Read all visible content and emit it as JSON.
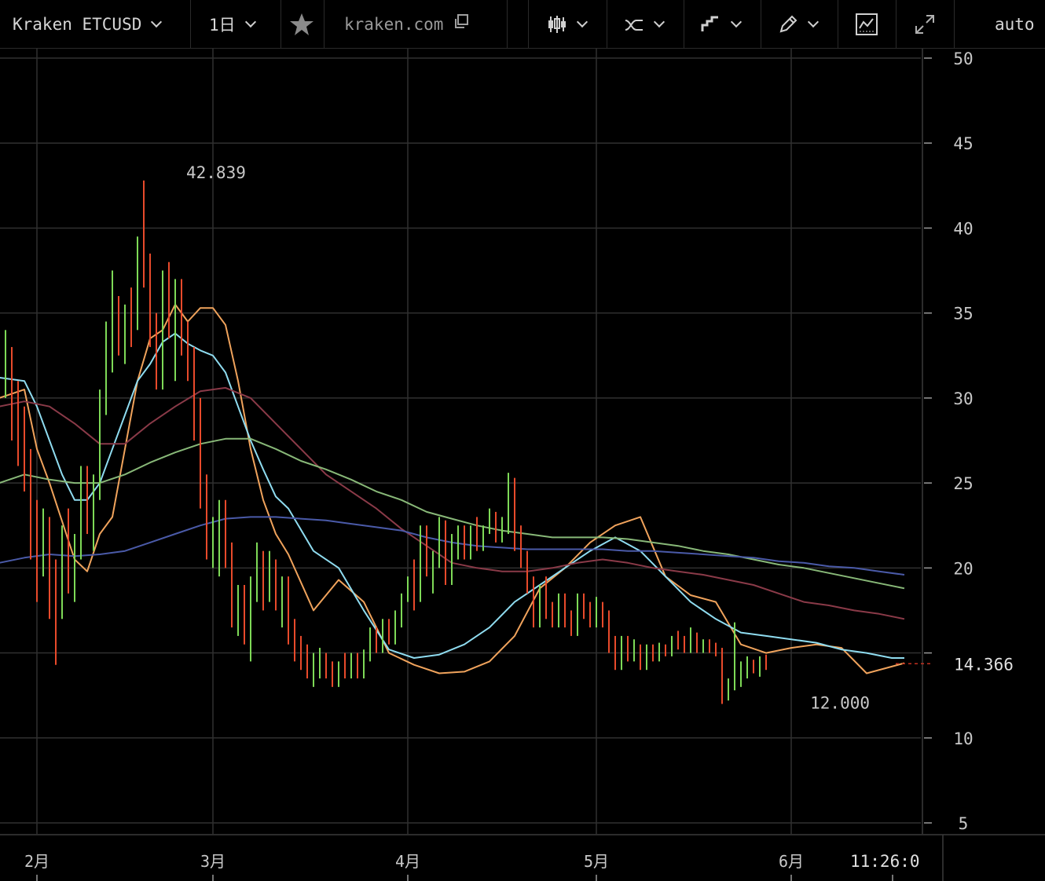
{
  "toolbar": {
    "symbol_label": "Kraken ETCUSD",
    "interval_label": "1日",
    "source_label": "kraken.com",
    "auto_label": "auto",
    "icons": [
      "star-icon",
      "external-link-icon",
      "candles-icon",
      "indicators-icon",
      "step-line-icon",
      "pencil-icon",
      "chart-settings-icon",
      "fullscreen-icon"
    ]
  },
  "colors": {
    "background": "#000000",
    "grid": "#303030",
    "up_bar": "#7ed957",
    "down_bar": "#e84a2b",
    "ma_orange": "#f0a35c",
    "ma_cyan": "#8fdcf0",
    "ma_red": "#8a3a48",
    "ma_green": "#88b878",
    "ma_blue": "#4a5aa8",
    "last_price_line": "#c03020"
  },
  "chart_data": {
    "type": "line",
    "title": "",
    "xlabel": "",
    "ylabel": "",
    "ylim": [
      3,
      51
    ],
    "y_ticks": [
      5,
      10,
      15,
      20,
      25,
      30,
      35,
      40,
      45,
      50
    ],
    "y_tick_labels": [
      "5",
      "10",
      "",
      "20",
      "25",
      "30",
      "35",
      "40",
      "45",
      "50"
    ],
    "x_tick_labels": [
      "2月",
      "3月",
      "4月",
      "5月",
      "6月"
    ],
    "x_tick_days": [
      2,
      30,
      61,
      91,
      122
    ],
    "x_range_days": [
      -4,
      140
    ],
    "last_price_label": "14.366",
    "last_price": 14.366,
    "high_label": "42.839",
    "high_value": 42.839,
    "high_day": 25,
    "low_label": "12.000",
    "low_value": 12.0,
    "low_day": 135,
    "time_label": "11:26:0",
    "bars": {
      "days_start": -4,
      "ohlc": [
        [
          30.2,
          33.5,
          29.5,
          31.5
        ],
        [
          31.5,
          34.0,
          30.0,
          32.5
        ],
        [
          32.5,
          33.0,
          27.5,
          30.5
        ],
        [
          30.5,
          31.0,
          26.0,
          28.5
        ],
        [
          28.5,
          29.5,
          24.5,
          26.0
        ],
        [
          26.0,
          27.0,
          20.5,
          23.0
        ],
        [
          23.0,
          24.0,
          18.0,
          21.0
        ],
        [
          21.0,
          23.5,
          19.5,
          22.5
        ],
        [
          22.5,
          23.0,
          17.0,
          19.0
        ],
        [
          19.0,
          20.5,
          14.3,
          17.5
        ],
        [
          17.5,
          22.5,
          17.0,
          21.5
        ],
        [
          21.5,
          23.5,
          18.5,
          19.5
        ],
        [
          19.5,
          22.0,
          18.0,
          21.5
        ],
        [
          21.5,
          26.0,
          20.5,
          25.0
        ],
        [
          25.0,
          26.0,
          22.0,
          23.5
        ],
        [
          23.5,
          25.5,
          21.0,
          24.5
        ],
        [
          24.5,
          30.5,
          24.0,
          30.0
        ],
        [
          30.0,
          34.5,
          29.0,
          33.5
        ],
        [
          33.5,
          37.5,
          31.5,
          35.0
        ],
        [
          35.0,
          36.0,
          32.5,
          33.5
        ],
        [
          33.5,
          35.5,
          32.0,
          35.0
        ],
        [
          35.0,
          36.5,
          33.0,
          34.5
        ],
        [
          34.5,
          39.5,
          34.0,
          38.0
        ],
        [
          38.0,
          42.8,
          36.5,
          37.5
        ],
        [
          37.5,
          38.5,
          33.0,
          34.5
        ],
        [
          34.5,
          35.0,
          30.5,
          31.5
        ],
        [
          31.5,
          37.5,
          30.5,
          36.5
        ],
        [
          36.5,
          38.0,
          33.5,
          34.0
        ],
        [
          34.0,
          37.0,
          31.0,
          35.5
        ],
        [
          35.5,
          37.0,
          32.5,
          33.0
        ],
        [
          33.0,
          34.5,
          31.0,
          32.5
        ],
        [
          32.5,
          33.0,
          27.5,
          29.0
        ],
        [
          29.0,
          30.0,
          23.5,
          25.0
        ],
        [
          25.0,
          25.5,
          20.5,
          21.5
        ],
        [
          21.5,
          23.0,
          20.0,
          22.0
        ],
        [
          22.0,
          24.0,
          19.5,
          23.5
        ],
        [
          23.5,
          24.0,
          20.0,
          21.0
        ],
        [
          21.0,
          21.5,
          16.5,
          17.5
        ],
        [
          17.5,
          19.0,
          16.0,
          18.5
        ],
        [
          18.5,
          19.0,
          15.5,
          16.5
        ],
        [
          16.5,
          19.5,
          14.5,
          19.0
        ],
        [
          19.0,
          21.5,
          18.0,
          20.5
        ],
        [
          20.5,
          21.0,
          17.5,
          18.5
        ],
        [
          18.5,
          21.0,
          18.0,
          20.5
        ],
        [
          20.5,
          20.5,
          17.5,
          18.0
        ],
        [
          18.0,
          19.5,
          16.5,
          19.0
        ],
        [
          19.0,
          19.5,
          15.5,
          16.5
        ],
        [
          16.5,
          17.0,
          14.5,
          15.5
        ],
        [
          15.5,
          16.0,
          14.0,
          14.8
        ],
        [
          14.8,
          15.5,
          13.5,
          14.0
        ],
        [
          14.0,
          15.0,
          13.0,
          14.5
        ],
        [
          14.5,
          15.3,
          13.5,
          14.8
        ],
        [
          14.8,
          15.0,
          13.5,
          14.0
        ],
        [
          14.0,
          14.5,
          13.0,
          13.5
        ],
        [
          13.5,
          14.5,
          13.0,
          14.2
        ],
        [
          14.2,
          15.0,
          13.5,
          14.0
        ],
        [
          14.0,
          15.0,
          13.5,
          14.5
        ],
        [
          14.5,
          15.0,
          13.5,
          14.0
        ],
        [
          14.0,
          15.2,
          13.5,
          15.0
        ],
        [
          15.0,
          16.5,
          14.5,
          16.0
        ],
        [
          16.0,
          16.5,
          15.0,
          15.5
        ],
        [
          15.5,
          17.0,
          15.0,
          16.8
        ],
        [
          16.8,
          17.0,
          15.5,
          16.0
        ],
        [
          16.0,
          17.5,
          15.5,
          17.0
        ],
        [
          17.0,
          18.5,
          16.5,
          18.2
        ],
        [
          18.2,
          19.5,
          18.0,
          19.3
        ],
        [
          19.3,
          20.5,
          17.5,
          18.0
        ],
        [
          18.0,
          22.5,
          18.0,
          22.0
        ],
        [
          22.0,
          22.5,
          19.5,
          20.0
        ],
        [
          20.0,
          21.0,
          18.5,
          20.5
        ],
        [
          20.5,
          23.0,
          20.0,
          22.5
        ],
        [
          22.5,
          22.8,
          19.0,
          19.5
        ],
        [
          19.5,
          22.0,
          19.0,
          21.5
        ],
        [
          21.5,
          22.5,
          20.5,
          22.0
        ],
        [
          22.0,
          22.5,
          20.5,
          21.0
        ],
        [
          21.0,
          22.5,
          20.5,
          22.0
        ],
        [
          22.0,
          23.0,
          21.0,
          21.8
        ],
        [
          21.8,
          22.5,
          21.0,
          22.2
        ],
        [
          22.2,
          23.5,
          22.0,
          23.0
        ],
        [
          23.0,
          23.3,
          21.5,
          22.0
        ],
        [
          22.0,
          23.0,
          21.5,
          22.5
        ],
        [
          22.5,
          25.6,
          22.0,
          23.0
        ],
        [
          23.0,
          25.3,
          21.0,
          22.0
        ],
        [
          22.0,
          22.5,
          20.0,
          20.5
        ],
        [
          20.5,
          21.0,
          18.5,
          19.0
        ],
        [
          19.0,
          19.5,
          16.5,
          17.5
        ],
        [
          17.5,
          19.0,
          16.5,
          18.5
        ],
        [
          18.5,
          19.5,
          17.0,
          17.5
        ],
        [
          17.5,
          18.0,
          16.5,
          17.0
        ],
        [
          17.0,
          18.5,
          16.5,
          18.0
        ],
        [
          18.0,
          18.5,
          16.5,
          17.0
        ],
        [
          17.0,
          17.5,
          16.0,
          16.5
        ],
        [
          16.5,
          18.5,
          16.0,
          18.0
        ],
        [
          18.0,
          18.5,
          17.0,
          17.5
        ],
        [
          17.5,
          18.0,
          16.5,
          17.0
        ],
        [
          17.0,
          18.3,
          16.5,
          17.8
        ],
        [
          17.8,
          18.0,
          16.5,
          17.0
        ],
        [
          17.0,
          17.5,
          15.0,
          15.5
        ],
        [
          15.5,
          16.0,
          14.0,
          14.5
        ],
        [
          14.5,
          16.0,
          14.0,
          15.5
        ],
        [
          15.5,
          16.0,
          14.5,
          15.0
        ],
        [
          15.0,
          15.8,
          14.5,
          15.3
        ],
        [
          15.3,
          15.5,
          14.0,
          14.5
        ],
        [
          14.5,
          15.5,
          14.0,
          15.2
        ],
        [
          15.2,
          15.5,
          14.5,
          14.8
        ],
        [
          14.8,
          15.6,
          14.5,
          15.4
        ],
        [
          15.4,
          15.5,
          14.8,
          15.0
        ],
        [
          15.0,
          16.0,
          14.8,
          15.8
        ],
        [
          15.8,
          16.3,
          15.2,
          15.5
        ],
        [
          15.5,
          16.0,
          15.0,
          15.3
        ],
        [
          15.3,
          16.5,
          15.0,
          16.0
        ],
        [
          16.0,
          16.2,
          15.0,
          15.4
        ],
        [
          15.4,
          15.8,
          15.0,
          15.6
        ],
        [
          15.6,
          15.8,
          15.0,
          15.2
        ],
        [
          15.2,
          15.6,
          14.8,
          15.0
        ],
        [
          15.0,
          15.3,
          12.0,
          12.8
        ],
        [
          12.8,
          13.5,
          12.2,
          13.2
        ],
        [
          13.2,
          16.8,
          12.8,
          14.0
        ],
        [
          14.0,
          14.5,
          13.0,
          14.2
        ],
        [
          14.2,
          14.8,
          13.5,
          14.4
        ],
        [
          14.4,
          14.6,
          13.8,
          14.0
        ],
        [
          14.0,
          14.8,
          13.6,
          14.5
        ],
        [
          14.5,
          14.9,
          14.0,
          14.366
        ]
      ]
    },
    "series": [
      {
        "name": "",
        "color_key": "ma_orange",
        "x": [
          -4,
          0,
          2,
          4,
          8,
          10,
          12,
          14,
          16,
          18,
          20,
          22,
          24,
          26,
          28,
          30,
          32,
          34,
          36,
          38,
          40,
          42,
          46,
          50,
          54,
          58,
          62,
          66,
          70,
          74,
          78,
          82,
          86,
          90,
          94,
          98,
          102,
          106,
          110,
          114,
          118,
          122,
          126,
          130,
          134,
          138,
          140
        ],
        "y": [
          30,
          30.5,
          27,
          25,
          20.5,
          19.8,
          22,
          23,
          27,
          31,
          33.5,
          34,
          35.5,
          34.5,
          35.3,
          35.3,
          34.3,
          31,
          27,
          24,
          22,
          20.8,
          17.5,
          19.3,
          18,
          15,
          14.3,
          13.8,
          13.9,
          14.5,
          16,
          18.8,
          20,
          21.5,
          22.5,
          23,
          19.5,
          18.4,
          18,
          15.5,
          15,
          15.3,
          15.5,
          15.3,
          13.8,
          14.2,
          14.4
        ]
      },
      {
        "name": "",
        "color_key": "ma_cyan",
        "x": [
          -4,
          0,
          2,
          4,
          6,
          8,
          10,
          12,
          14,
          16,
          18,
          20,
          22,
          24,
          26,
          28,
          30,
          32,
          34,
          36,
          38,
          40,
          42,
          46,
          50,
          54,
          58,
          62,
          66,
          70,
          74,
          78,
          82,
          86,
          90,
          94,
          98,
          102,
          106,
          110,
          114,
          118,
          122,
          126,
          130,
          134,
          138,
          140
        ],
        "y": [
          31.2,
          31,
          29.5,
          27.5,
          25.5,
          24,
          24,
          25,
          27,
          29,
          31,
          32,
          33.3,
          33.8,
          33.2,
          32.8,
          32.5,
          31.5,
          29.5,
          27.5,
          25.8,
          24.2,
          23.5,
          21,
          20,
          17.5,
          15.2,
          14.7,
          14.9,
          15.5,
          16.5,
          18,
          19,
          20,
          21,
          21.8,
          21,
          19.5,
          18,
          17,
          16.2,
          16,
          15.8,
          15.6,
          15.2,
          15,
          14.7,
          14.7
        ]
      },
      {
        "name": "",
        "color_key": "ma_red",
        "x": [
          -4,
          0,
          4,
          8,
          12,
          16,
          20,
          24,
          28,
          32,
          36,
          40,
          44,
          48,
          52,
          56,
          60,
          64,
          68,
          72,
          76,
          80,
          84,
          88,
          92,
          96,
          100,
          104,
          108,
          112,
          116,
          120,
          124,
          128,
          132,
          136,
          140
        ],
        "y": [
          29.5,
          29.8,
          29.5,
          28.5,
          27.3,
          27.3,
          28.5,
          29.5,
          30.4,
          30.6,
          30,
          28.5,
          27,
          25.5,
          24.5,
          23.5,
          22.3,
          21.3,
          20.3,
          20,
          19.8,
          19.8,
          20,
          20.3,
          20.5,
          20.3,
          20,
          19.8,
          19.6,
          19.3,
          19,
          18.5,
          18,
          17.8,
          17.5,
          17.3,
          17
        ]
      },
      {
        "name": "",
        "color_key": "ma_green",
        "x": [
          -4,
          0,
          4,
          8,
          12,
          16,
          20,
          24,
          28,
          32,
          36,
          40,
          44,
          48,
          52,
          56,
          60,
          64,
          68,
          72,
          76,
          80,
          84,
          88,
          92,
          96,
          100,
          104,
          108,
          112,
          116,
          120,
          124,
          128,
          132,
          136,
          140
        ],
        "y": [
          25,
          25.5,
          25.2,
          25,
          25,
          25.5,
          26.2,
          26.8,
          27.3,
          27.6,
          27.6,
          27,
          26.3,
          25.8,
          25.2,
          24.5,
          24,
          23.3,
          22.9,
          22.5,
          22.2,
          22,
          21.8,
          21.8,
          21.8,
          21.7,
          21.5,
          21.3,
          21,
          20.8,
          20.5,
          20.2,
          20,
          19.7,
          19.4,
          19.1,
          18.8
        ]
      },
      {
        "name": "",
        "color_key": "ma_blue",
        "x": [
          -4,
          0,
          4,
          8,
          12,
          16,
          20,
          24,
          28,
          32,
          36,
          40,
          44,
          48,
          52,
          56,
          60,
          64,
          68,
          72,
          76,
          80,
          84,
          88,
          92,
          96,
          100,
          104,
          108,
          112,
          116,
          120,
          124,
          128,
          132,
          136,
          140
        ],
        "y": [
          20.3,
          20.6,
          20.8,
          20.7,
          20.8,
          21,
          21.5,
          22,
          22.5,
          22.9,
          23,
          23,
          22.9,
          22.8,
          22.6,
          22.4,
          22.2,
          21.8,
          21.5,
          21.3,
          21.2,
          21.1,
          21.1,
          21.1,
          21.1,
          21,
          21,
          20.9,
          20.8,
          20.7,
          20.6,
          20.4,
          20.3,
          20.1,
          20,
          19.8,
          19.6
        ]
      }
    ]
  }
}
